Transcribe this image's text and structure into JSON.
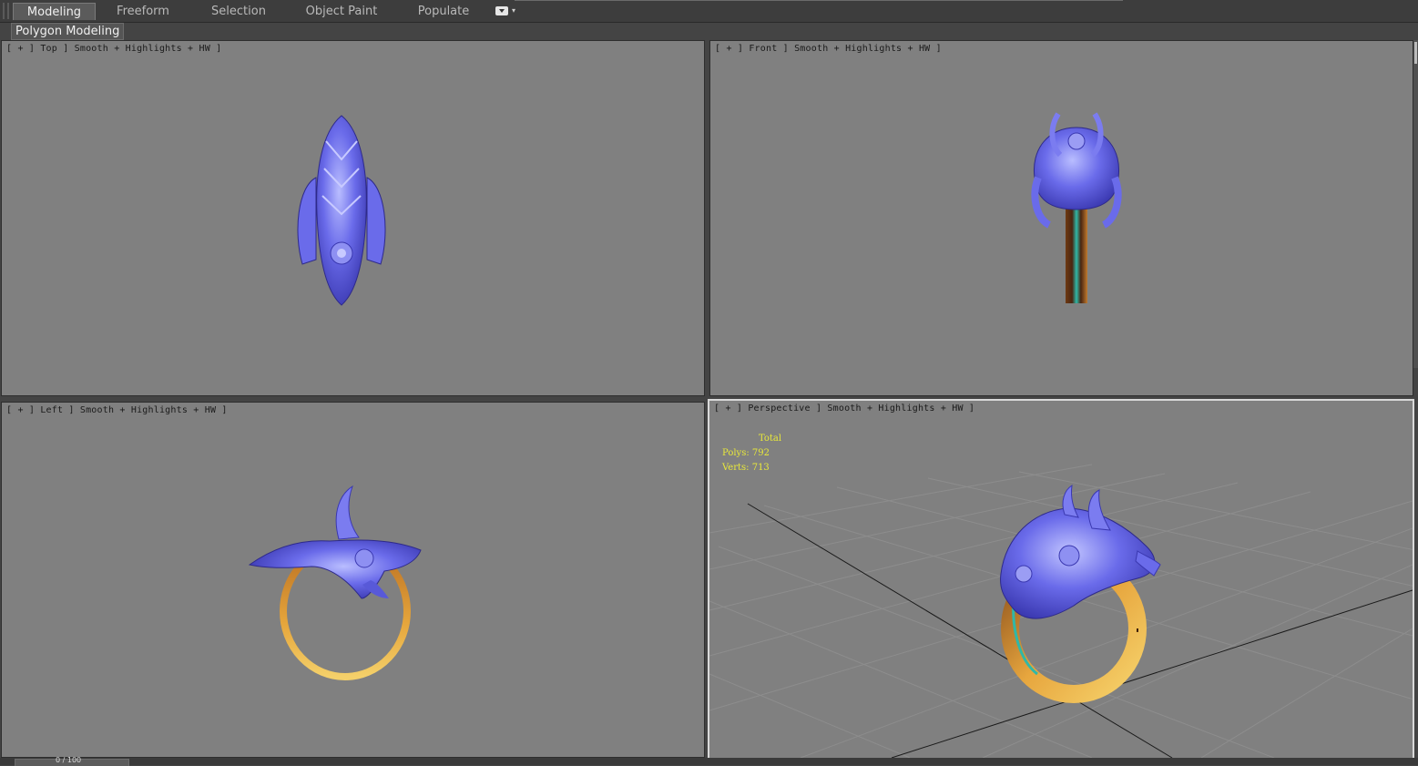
{
  "ribbon": {
    "tabs": [
      {
        "label": "Modeling",
        "active": true
      },
      {
        "label": "Freeform",
        "active": false
      },
      {
        "label": "Selection",
        "active": false
      },
      {
        "label": "Object Paint",
        "active": false
      },
      {
        "label": "Populate",
        "active": false
      }
    ],
    "panel_label": "Polygon Modeling"
  },
  "viewports": {
    "top": {
      "label": "[ + ] Top ] Smooth + Highlights + HW ]"
    },
    "front": {
      "label": "[ + ] Front ] Smooth + Highlights + HW ]"
    },
    "left": {
      "label": "[ + ] Left ] Smooth + Highlights + HW ]"
    },
    "perspective": {
      "label": "[ + ] Perspective ] Smooth + Highlights + HW ]",
      "stats": {
        "header": "Total",
        "polys": "Polys: 792",
        "verts": "Verts: 713"
      }
    }
  },
  "timeline": {
    "frame": "0 / 100"
  },
  "colors": {
    "viewport_bg": "#808080",
    "ring_blue": "#6f6ee6",
    "ring_gold": "#e2a33a",
    "stats_text": "#e8e83a",
    "active_border": "#d9d9d9"
  }
}
